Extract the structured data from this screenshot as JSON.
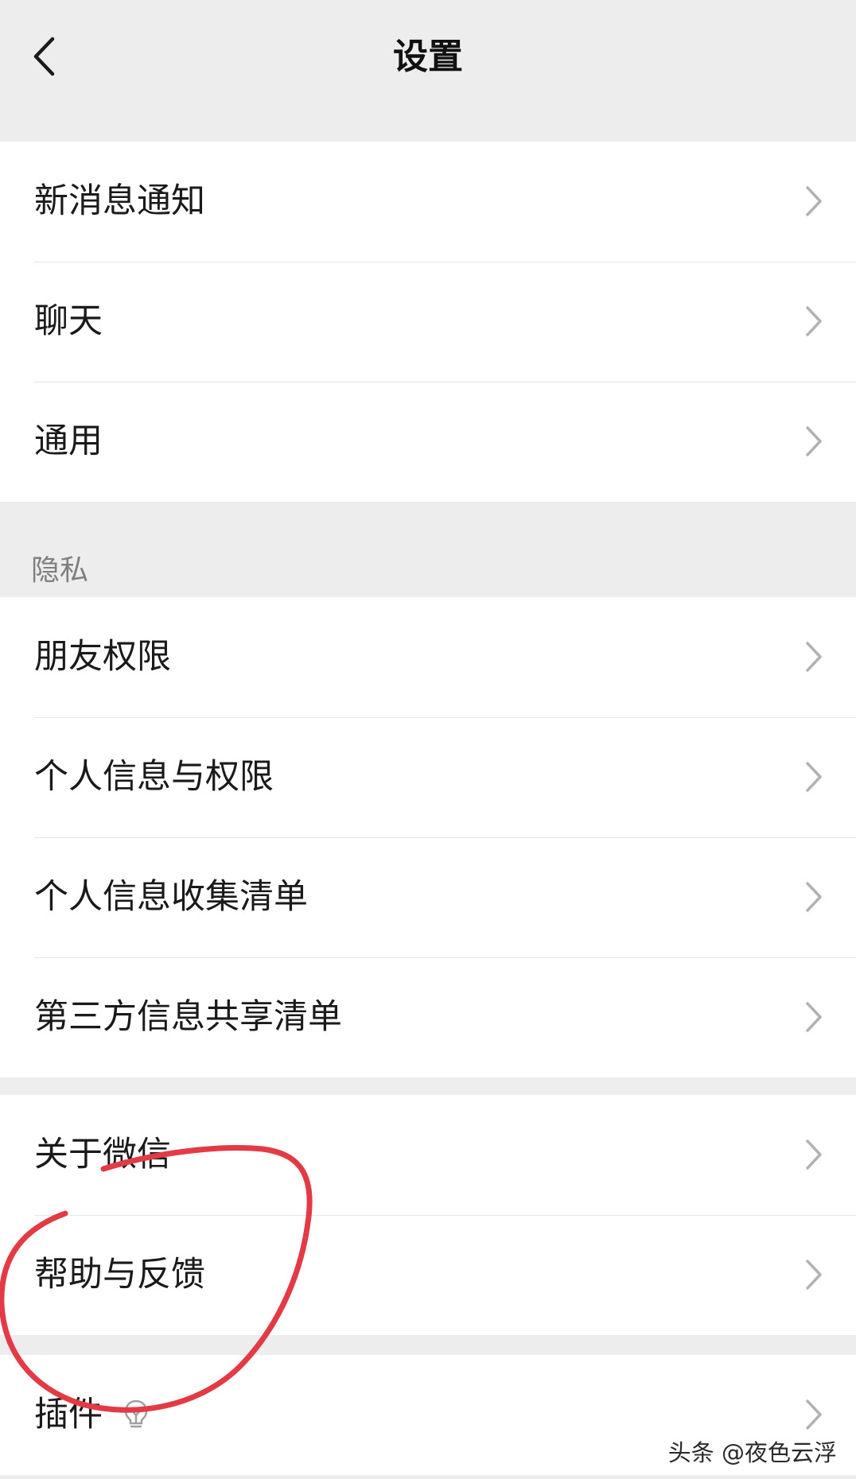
{
  "header": {
    "title": "设置"
  },
  "groups": [
    {
      "items": [
        {
          "label": "新消息通知"
        },
        {
          "label": "聊天"
        },
        {
          "label": "通用"
        }
      ]
    },
    {
      "section_title": "隐私",
      "items": [
        {
          "label": "朋友权限"
        },
        {
          "label": "个人信息与权限"
        },
        {
          "label": "个人信息收集清单"
        },
        {
          "label": "第三方信息共享清单"
        }
      ]
    },
    {
      "items": [
        {
          "label": "关于微信"
        },
        {
          "label": "帮助与反馈"
        }
      ]
    },
    {
      "items": [
        {
          "label": "插件",
          "icon": "plugin-bulb-icon"
        }
      ]
    }
  ],
  "watermark": "头条 @夜色云浮",
  "colors": {
    "background": "#ededed",
    "row_background": "#ffffff",
    "chevron": "#b2b2b2",
    "annotation": "#e23b45"
  }
}
